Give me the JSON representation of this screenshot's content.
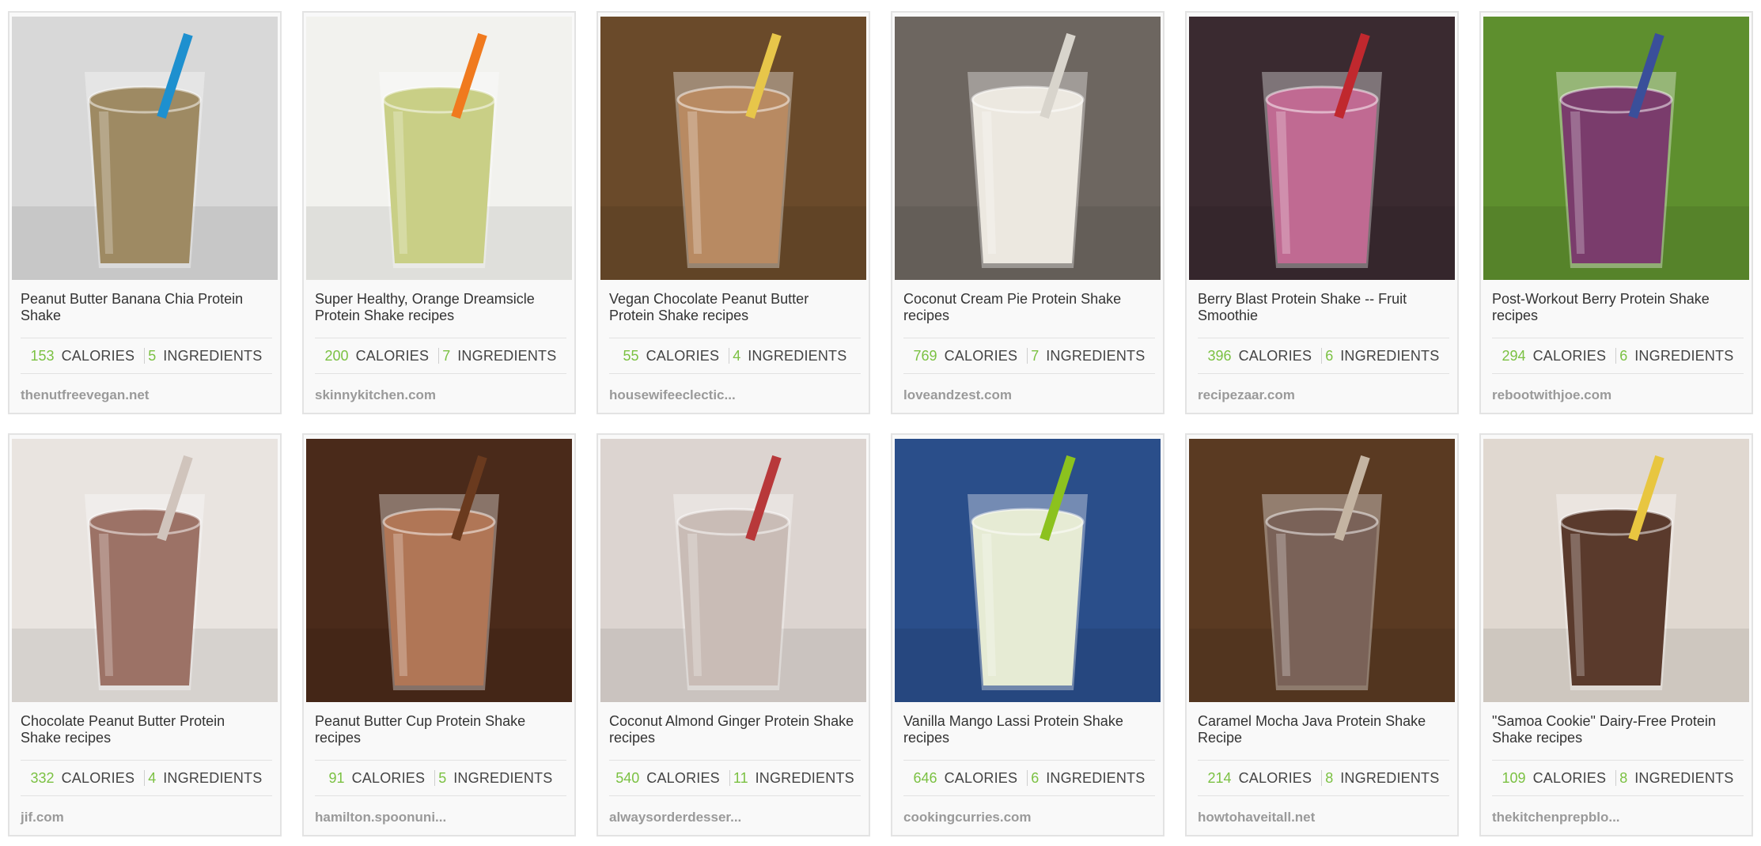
{
  "cards": [
    {
      "title": "Peanut Butter Banana Chia Protein Shake",
      "calories": "153",
      "calories_label": "CALORIES",
      "ingredients": "5",
      "ingredients_label": "INGREDIENTS",
      "source": "thenutfreevegan.net",
      "image_icon": "smoothie-photo",
      "colors": {
        "bg": "#d8d8d8",
        "drink": "#9e8a63",
        "accent": "#1e90cf"
      }
    },
    {
      "title": "Super Healthy, Orange Dreamsicle Protein Shake recipes",
      "calories": "200",
      "calories_label": "CALORIES",
      "ingredients": "7",
      "ingredients_label": "INGREDIENTS",
      "source": "skinnykitchen.com",
      "image_icon": "smoothie-photo",
      "colors": {
        "bg": "#f2f2ee",
        "drink": "#c9cf86",
        "accent": "#f07a1e"
      }
    },
    {
      "title": "Vegan Chocolate Peanut Butter Protein Shake recipes",
      "calories": "55",
      "calories_label": "CALORIES",
      "ingredients": "4",
      "ingredients_label": "INGREDIENTS",
      "source": "housewifeeclectic...",
      "image_icon": "smoothie-photo",
      "colors": {
        "bg": "#6a4a2a",
        "drink": "#b88a62",
        "accent": "#e7c64a"
      }
    },
    {
      "title": "Coconut Cream Pie Protein Shake recipes",
      "calories": "769",
      "calories_label": "CALORIES",
      "ingredients": "7",
      "ingredients_label": "INGREDIENTS",
      "source": "loveandzest.com",
      "image_icon": "smoothie-photo",
      "colors": {
        "bg": "#6d6660",
        "drink": "#ece8e0",
        "accent": "#d8d4cc"
      }
    },
    {
      "title": "Berry Blast Protein Shake -- Fruit Smoothie",
      "calories": "396",
      "calories_label": "CALORIES",
      "ingredients": "6",
      "ingredients_label": "INGREDIENTS",
      "source": "recipezaar.com",
      "image_icon": "smoothie-photo",
      "colors": {
        "bg": "#3a2a30",
        "drink": "#c06a92",
        "accent": "#c0282e"
      }
    },
    {
      "title": "Post-Workout Berry Protein Shake recipes",
      "calories": "294",
      "calories_label": "CALORIES",
      "ingredients": "6",
      "ingredients_label": "INGREDIENTS",
      "source": "rebootwithjoe.com",
      "image_icon": "smoothie-photo",
      "colors": {
        "bg": "#5e8f2e",
        "drink": "#7a3c6c",
        "accent": "#3a4f9a"
      }
    },
    {
      "title": "Chocolate Peanut Butter Protein Shake recipes",
      "calories": "332",
      "calories_label": "CALORIES",
      "ingredients": "4",
      "ingredients_label": "INGREDIENTS",
      "source": "jif.com",
      "image_icon": "smoothie-photo",
      "colors": {
        "bg": "#e9e4e0",
        "drink": "#9c7266",
        "accent": "#d0c4bc"
      }
    },
    {
      "title": "Peanut Butter Cup Protein Shake recipes",
      "calories": "91",
      "calories_label": "CALORIES",
      "ingredients": "5",
      "ingredients_label": "INGREDIENTS",
      "source": "hamilton.spoonuni...",
      "image_icon": "smoothie-photo",
      "colors": {
        "bg": "#4a2a1a",
        "drink": "#b07656",
        "accent": "#6a3a1e"
      }
    },
    {
      "title": "Coconut Almond Ginger Protein Shake recipes",
      "calories": "540",
      "calories_label": "CALORIES",
      "ingredients": "11",
      "ingredients_label": "INGREDIENTS",
      "source": "alwaysorderdesser...",
      "image_icon": "smoothie-photo",
      "colors": {
        "bg": "#dcd4d0",
        "drink": "#c9bcb6",
        "accent": "#b8383a"
      }
    },
    {
      "title": "Vanilla Mango Lassi Protein Shake recipes",
      "calories": "646",
      "calories_label": "CALORIES",
      "ingredients": "6",
      "ingredients_label": "INGREDIENTS",
      "source": "cookingcurries.com",
      "image_icon": "smoothie-photo",
      "colors": {
        "bg": "#2a4e8a",
        "drink": "#e6ebd4",
        "accent": "#8cc21e"
      }
    },
    {
      "title": "Caramel Mocha Java Protein Shake Recipe",
      "calories": "214",
      "calories_label": "CALORIES",
      "ingredients": "8",
      "ingredients_label": "INGREDIENTS",
      "source": "howtohaveitall.net",
      "image_icon": "smoothie-photo",
      "colors": {
        "bg": "#5a3a22",
        "drink": "#7a6258",
        "accent": "#c4b4a2"
      }
    },
    {
      "title": "\"Samoa Cookie\" Dairy-Free Protein Shake recipes",
      "calories": "109",
      "calories_label": "CALORIES",
      "ingredients": "8",
      "ingredients_label": "INGREDIENTS",
      "source": "thekitchenprepblo...",
      "image_icon": "smoothie-photo",
      "colors": {
        "bg": "#e0d8d0",
        "drink": "#5a3a2c",
        "accent": "#e8c640"
      }
    }
  ]
}
